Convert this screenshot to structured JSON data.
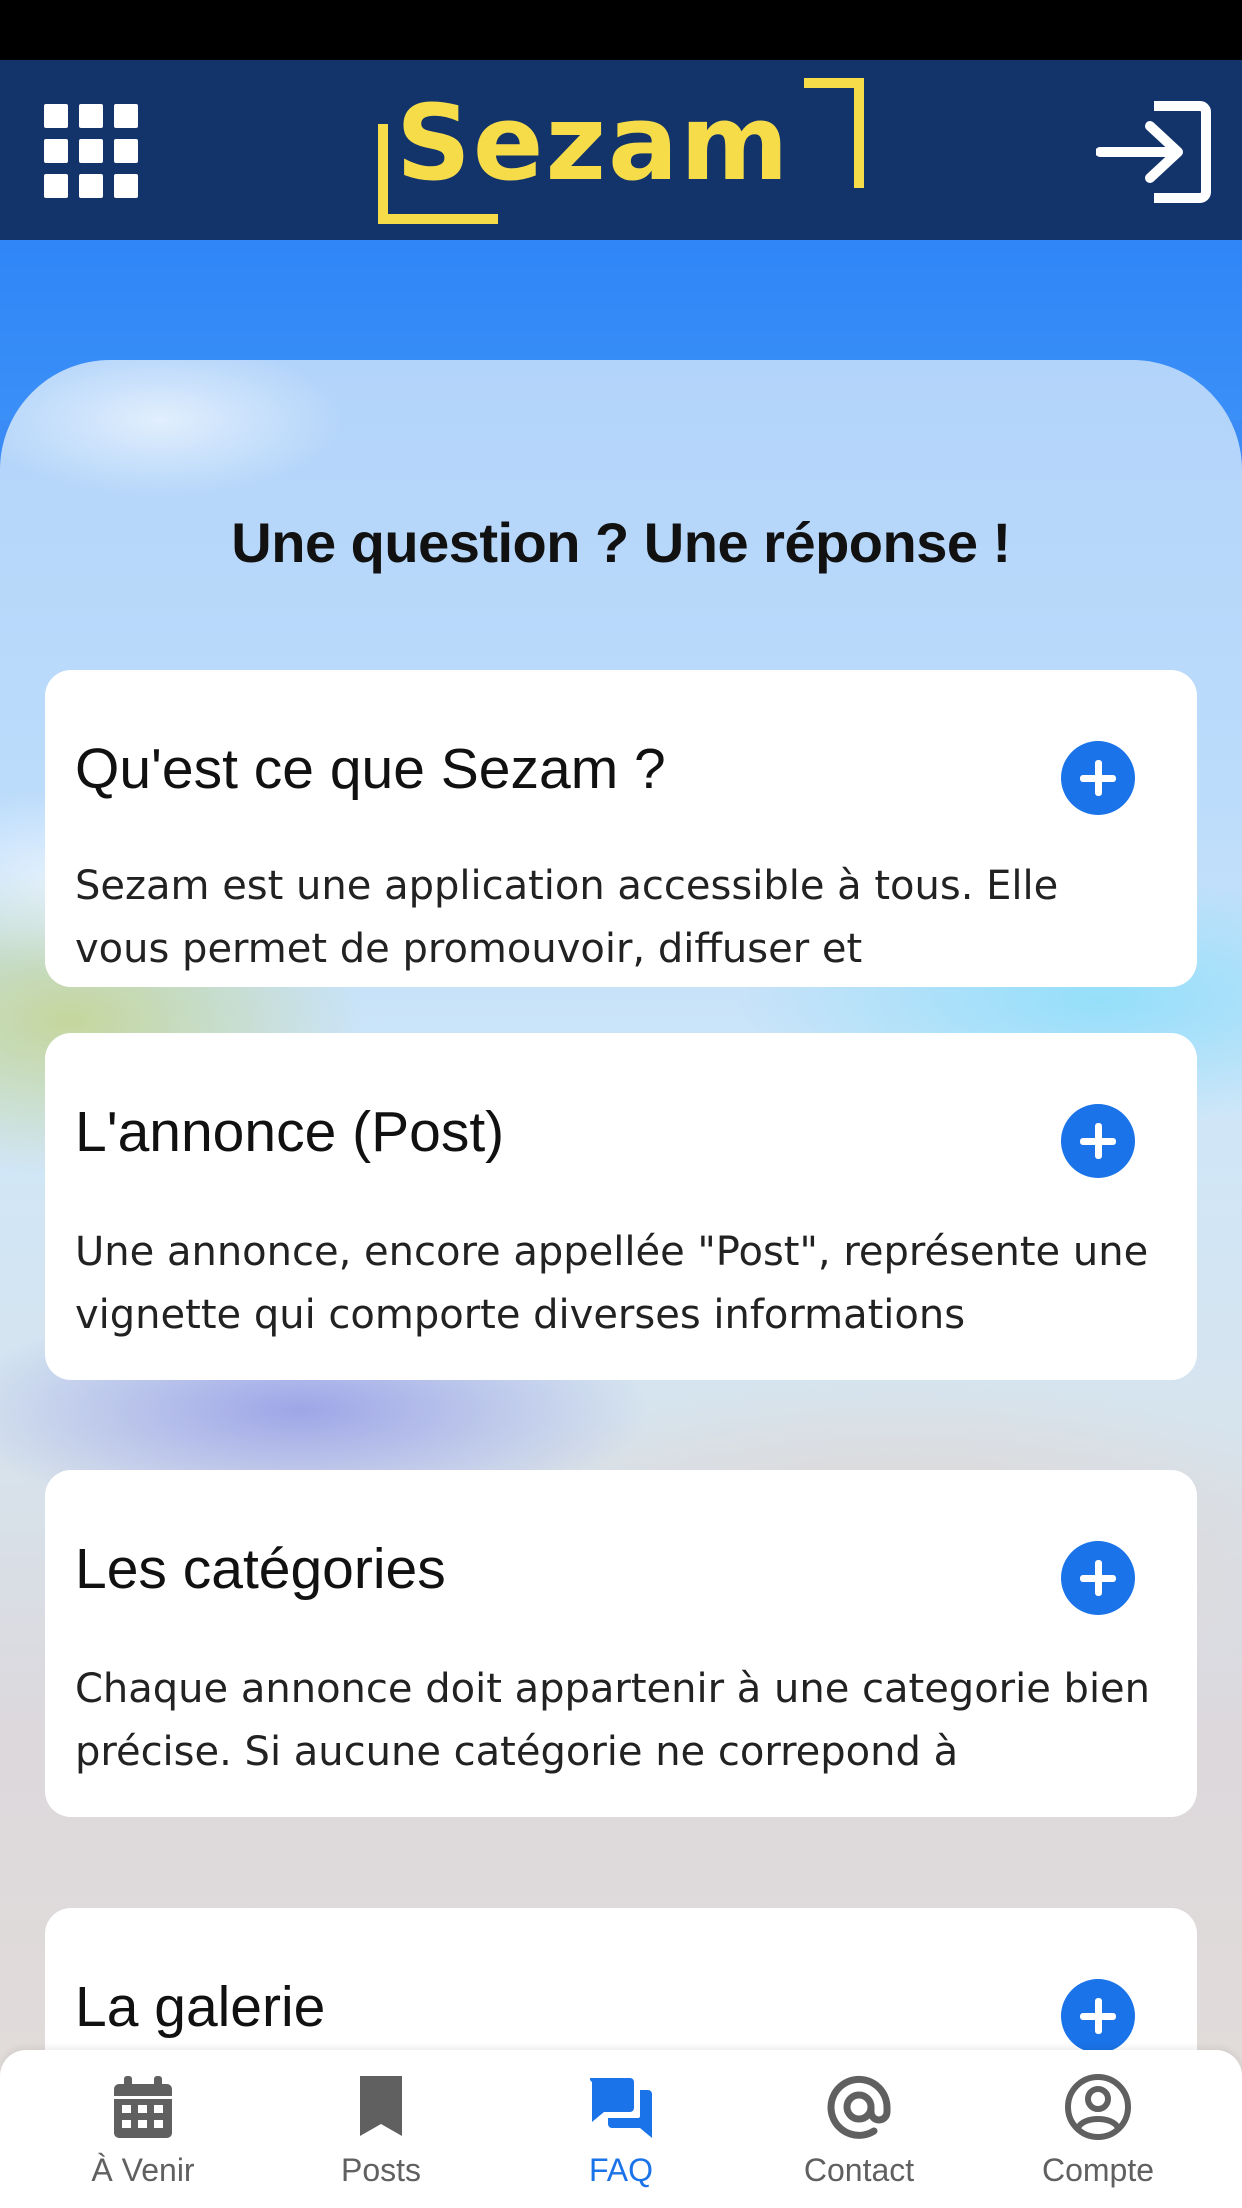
{
  "header": {
    "menu_icon": "grid-menu-icon",
    "logo_text": "Sezam",
    "login_icon": "login-icon"
  },
  "faq": {
    "title": "Une question ? Une réponse !",
    "items": [
      {
        "question": "Qu'est ce que Sezam ?",
        "answer": "Sezam est une application accessible à tous. Elle vous permet de promouvoir, diffuser et",
        "icon": "plus-circle-icon"
      },
      {
        "question": "L'annonce (Post)",
        "answer": "Une annonce, encore appellée \"Post\", représente une vignette qui comporte diverses informations",
        "icon": "plus-circle-icon"
      },
      {
        "question": "Les catégories",
        "answer": "Chaque annonce doit appartenir à une categorie bien précise. Si aucune catégorie ne correpond à",
        "icon": "plus-circle-icon"
      },
      {
        "question": "La galerie",
        "answer": "",
        "icon": "plus-circle-icon"
      }
    ]
  },
  "bottom_nav": {
    "items": [
      {
        "label": "À Venir",
        "icon": "calendar-icon",
        "active": false
      },
      {
        "label": "Posts",
        "icon": "bookmark-icon",
        "active": false
      },
      {
        "label": "FAQ",
        "icon": "forum-icon",
        "active": true
      },
      {
        "label": "Contact",
        "icon": "at-sign-icon",
        "active": false
      },
      {
        "label": "Compte",
        "icon": "account-circle-icon",
        "active": false
      }
    ]
  },
  "colors": {
    "header_bg": "#13346a",
    "logo": "#f7dc4a",
    "accent": "#1a73e8",
    "nav_inactive": "#606060"
  }
}
